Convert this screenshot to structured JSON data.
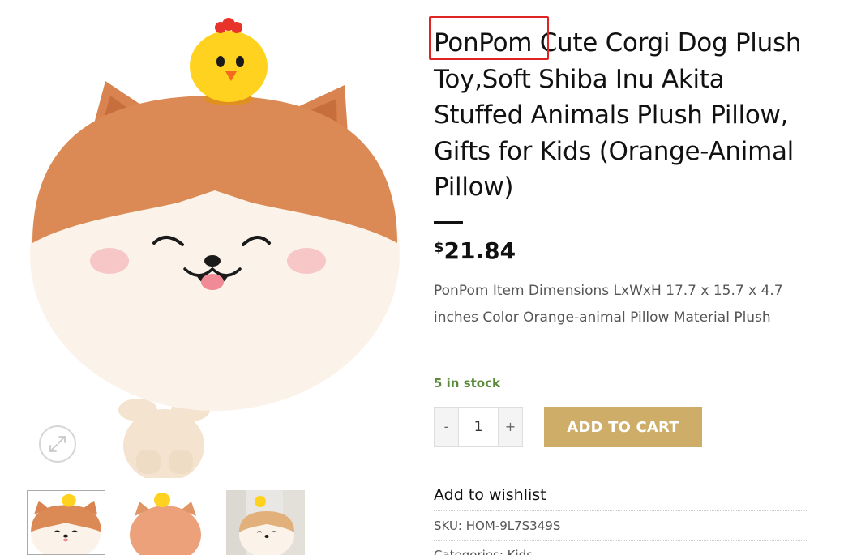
{
  "product": {
    "brand": "PonPom",
    "title_rest": " Cute Corgi Dog Plush Toy,Soft Shiba Inu Akita Stuffed Animals Plush Pillow, Gifts for Kids (Orange-Animal Pillow)",
    "price_currency": "$",
    "price_amount": "21.84",
    "description": "PonPom Item Dimensions LxWxH 17.7 x 15.7 x 4.7 inches Color Orange-animal Pillow Material Plush",
    "stock": "5 in stock",
    "sku_label": "SKU:",
    "sku_value": "HOM-9L7S349S",
    "categories_partial": "Categories: Kids"
  },
  "cart": {
    "minus_label": "-",
    "plus_label": "+",
    "quantity": "1",
    "add_to_cart_label": "ADD TO CART"
  },
  "wishlist": {
    "label": "Add to wishlist"
  },
  "gallery": {
    "zoom_icon": "expand-arrows-icon",
    "thumbnails": [
      "thumbnail-front",
      "thumbnail-back",
      "thumbnail-lifestyle"
    ],
    "active_thumbnail": 0
  },
  "colors": {
    "accent_button": "#cdad67",
    "stock_green": "#5a8a3c",
    "highlight_red": "#e02424",
    "plush_orange": "#dc8a55",
    "plush_cream": "#fbf3ea"
  }
}
